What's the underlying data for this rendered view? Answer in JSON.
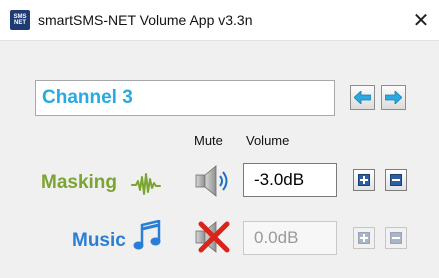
{
  "window": {
    "title": "smartSMS-NET Volume App v3.3n",
    "app_icon_text": [
      "SMS",
      "NET"
    ],
    "close_glyph": "✕"
  },
  "channel": {
    "name": "Channel 3"
  },
  "headers": {
    "mute": "Mute",
    "volume": "Volume"
  },
  "rows": [
    {
      "label": "Masking",
      "label_color": "#7aa533",
      "icon": "waveform-icon",
      "muted": false,
      "volume": "-3.0dB",
      "enabled": true
    },
    {
      "label": "Music",
      "label_color": "#2a7fd4",
      "icon": "music-note-icon",
      "muted": true,
      "volume": "0.0dB",
      "enabled": false
    }
  ],
  "colors": {
    "channel_text": "#27aae1",
    "nav_arrow": "#27aae1"
  }
}
